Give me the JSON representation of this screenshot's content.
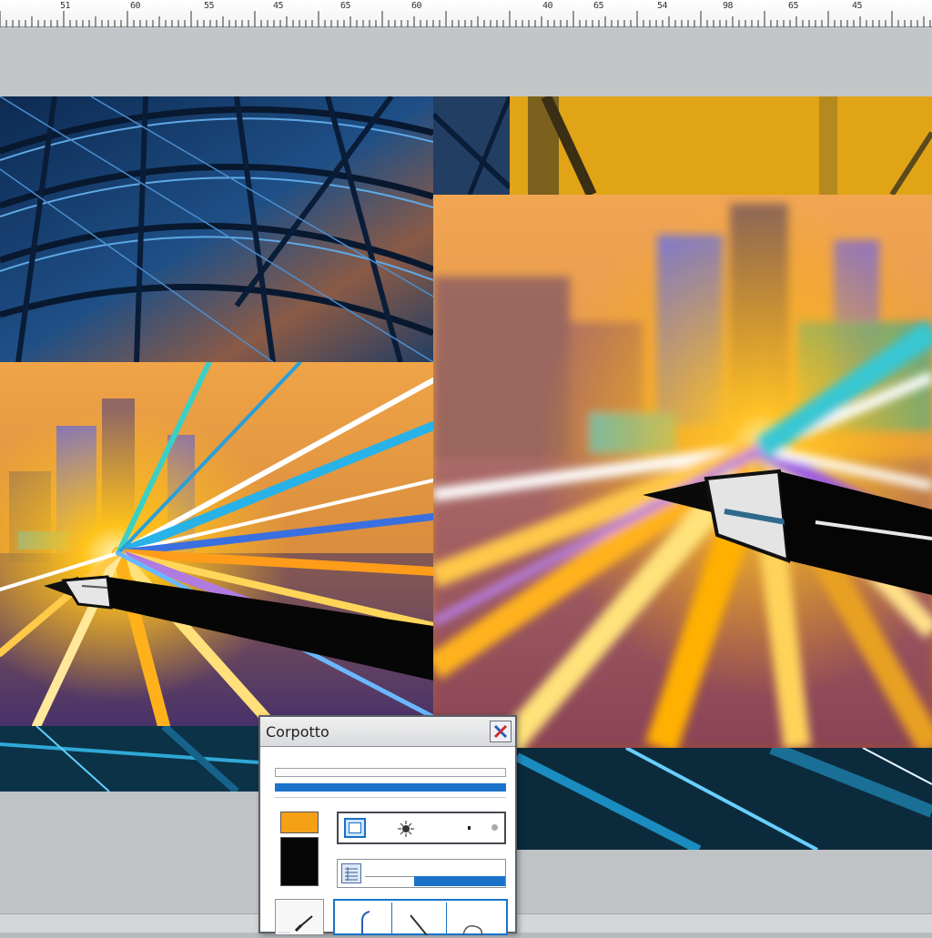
{
  "ruler": {
    "labels": [
      "51",
      "60",
      "55",
      "45",
      "65",
      "60",
      "40",
      "65",
      "54",
      "98",
      "65",
      "45"
    ]
  },
  "dialog": {
    "title": "Corpotto",
    "close_icon": "close-x-icon",
    "progress_empty": 0,
    "progress_full": 1,
    "primary_color": "#f5a116",
    "secondary_color": "#060606",
    "slider_level": 0.55
  },
  "icons": {
    "tool_row_1": [
      "frame-icon",
      "brush-icon"
    ],
    "tool_row_2": [
      "grid-icon"
    ],
    "brush_tabs": [
      "brush-hook-icon",
      "brush-stroke-icon",
      "brush-loop-icon"
    ]
  },
  "colors": {
    "accent": "#1a73c9",
    "workspace": "#c0c3c6",
    "canvas_orange": "#f0a447",
    "canvas_blue": "#1d4f8c"
  }
}
